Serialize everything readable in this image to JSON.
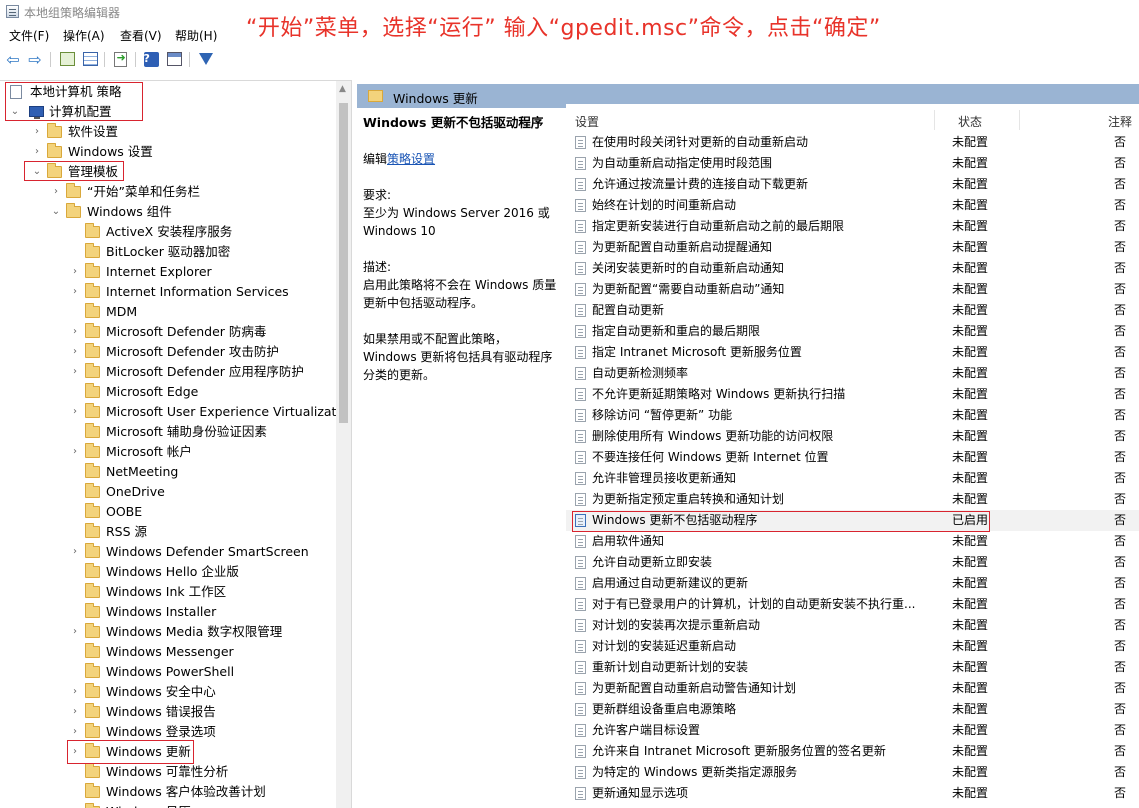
{
  "window": {
    "title": "本地组策略编辑器",
    "annotation": "“开始”菜单，选择“运行” 输入“gpedit.msc”命令，点击“确定”"
  },
  "menu": [
    "文件(F)",
    "操作(A)",
    "查看(V)",
    "帮助(H)"
  ],
  "toolbar": {
    "icons": [
      "back-arrow-icon",
      "forward-arrow-icon",
      "up-folder-icon",
      "show-hide-tree-icon",
      "export-list-icon",
      "help-icon",
      "properties-icon",
      "filter-icon"
    ]
  },
  "tree": {
    "root": "本地计算机 策略",
    "computer_config": "计算机配置",
    "items": [
      "软件设置",
      "Windows 设置",
      "管理模板",
      "“开始”菜单和任务栏",
      "Windows 组件",
      "ActiveX 安装程序服务",
      "BitLocker 驱动器加密",
      "Internet Explorer",
      "Internet Information Services",
      "MDM",
      "Microsoft Defender 防病毒",
      "Microsoft Defender 攻击防护",
      "Microsoft Defender 应用程序防护",
      "Microsoft Edge",
      "Microsoft User Experience Virtualization",
      "Microsoft 辅助身份验证因素",
      "Microsoft 帐户",
      "NetMeeting",
      "OneDrive",
      "OOBE",
      "RSS 源",
      "Windows Defender SmartScreen",
      "Windows Hello 企业版",
      "Windows Ink 工作区",
      "Windows Installer",
      "Windows Media 数字权限管理",
      "Windows Messenger",
      "Windows PowerShell",
      "Windows 安全中心",
      "Windows 错误报告",
      "Windows 登录选项",
      "Windows 更新",
      "Windows 可靠性分析",
      "Windows 客户体验改善计划",
      "Windows 日历"
    ]
  },
  "right": {
    "header": "Windows 更新",
    "description": {
      "title": "Windows 更新不包括驱动程序",
      "edit_prefix": "编辑",
      "edit_link": "策略设置",
      "req_label": "要求:",
      "req_text": "至少为 Windows Server 2016 或 Windows 10",
      "desc_label": "描述:",
      "desc_text": "启用此策略将不会在 Windows 质量更新中包括驱动程序。",
      "desc_text2": "如果禁用或不配置此策略，Windows 更新将包括具有驱动程序分类的更新。"
    },
    "columns": [
      "设置",
      "状态",
      "注释"
    ],
    "rows": [
      {
        "name": "在使用时段关闭针对更新的自动重新启动",
        "state": "未配置",
        "note": "否"
      },
      {
        "name": "为自动重新启动指定使用时段范围",
        "state": "未配置",
        "note": "否"
      },
      {
        "name": "允许通过按流量计费的连接自动下载更新",
        "state": "未配置",
        "note": "否"
      },
      {
        "name": "始终在计划的时间重新启动",
        "state": "未配置",
        "note": "否"
      },
      {
        "name": "指定更新安装进行自动重新启动之前的最后期限",
        "state": "未配置",
        "note": "否"
      },
      {
        "name": "为更新配置自动重新启动提醒通知",
        "state": "未配置",
        "note": "否"
      },
      {
        "name": "关闭安装更新时的自动重新启动通知",
        "state": "未配置",
        "note": "否"
      },
      {
        "name": "为更新配置“需要自动重新启动”通知",
        "state": "未配置",
        "note": "否"
      },
      {
        "name": "配置自动更新",
        "state": "未配置",
        "note": "否"
      },
      {
        "name": "指定自动更新和重启的最后期限",
        "state": "未配置",
        "note": "否"
      },
      {
        "name": "指定 Intranet Microsoft 更新服务位置",
        "state": "未配置",
        "note": "否"
      },
      {
        "name": "自动更新检测频率",
        "state": "未配置",
        "note": "否"
      },
      {
        "name": "不允许更新延期策略对 Windows 更新执行扫描",
        "state": "未配置",
        "note": "否"
      },
      {
        "name": "移除访问 “暂停更新” 功能",
        "state": "未配置",
        "note": "否"
      },
      {
        "name": "删除使用所有 Windows 更新功能的访问权限",
        "state": "未配置",
        "note": "否"
      },
      {
        "name": "不要连接任何 Windows 更新 Internet 位置",
        "state": "未配置",
        "note": "否"
      },
      {
        "name": "允许非管理员接收更新通知",
        "state": "未配置",
        "note": "否"
      },
      {
        "name": "为更新指定预定重启转换和通知计划",
        "state": "未配置",
        "note": "否"
      },
      {
        "name": "Windows 更新不包括驱动程序",
        "state": "已启用",
        "note": "否"
      },
      {
        "name": "启用软件通知",
        "state": "未配置",
        "note": "否"
      },
      {
        "name": "允许自动更新立即安装",
        "state": "未配置",
        "note": "否"
      },
      {
        "name": "启用通过自动更新建议的更新",
        "state": "未配置",
        "note": "否"
      },
      {
        "name": "对于有已登录用户的计算机，计划的自动更新安装不执行重...",
        "state": "未配置",
        "note": "否"
      },
      {
        "name": "对计划的安装再次提示重新启动",
        "state": "未配置",
        "note": "否"
      },
      {
        "name": "对计划的安装延迟重新启动",
        "state": "未配置",
        "note": "否"
      },
      {
        "name": "重新计划自动更新计划的安装",
        "state": "未配置",
        "note": "否"
      },
      {
        "name": "为更新配置自动重新启动警告通知计划",
        "state": "未配置",
        "note": "否"
      },
      {
        "name": "更新群组设备重启电源策略",
        "state": "未配置",
        "note": "否"
      },
      {
        "name": "允许客户端目标设置",
        "state": "未配置",
        "note": "否"
      },
      {
        "name": "允许来自 Intranet Microsoft 更新服务位置的签名更新",
        "state": "未配置",
        "note": "否"
      },
      {
        "name": "为特定的 Windows 更新类指定源服务",
        "state": "未配置",
        "note": "否"
      },
      {
        "name": "更新通知显示选项",
        "state": "未配置",
        "note": "否"
      }
    ]
  }
}
